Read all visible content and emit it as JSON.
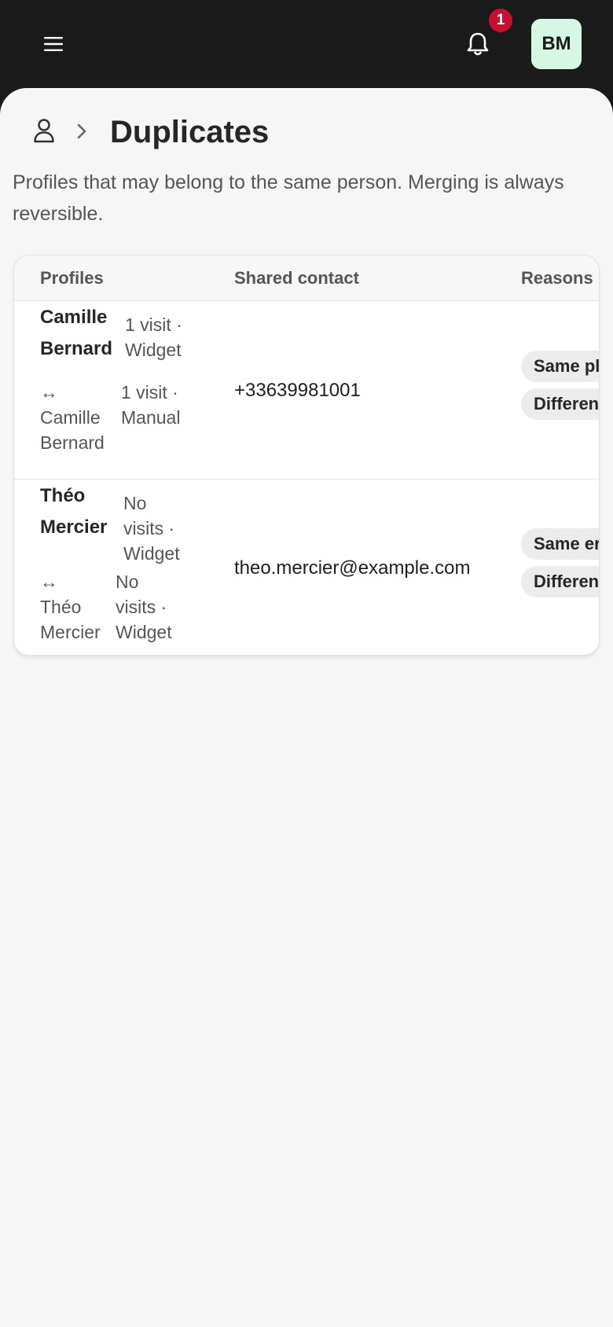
{
  "header": {
    "menu_icon": "hamburger-menu-icon",
    "bell_icon": "bell-icon",
    "notification_count": "1",
    "avatar_initials": "BM",
    "avatar_color": "#d6f7e3",
    "badge_color": "#c8102e"
  },
  "breadcrumb": {
    "root_icon": "person-icon",
    "separator_icon": "chevron-right-icon",
    "title": "Duplicates"
  },
  "description": "Profiles that may belong to the same person. Merging is always reversible.",
  "table": {
    "columns": [
      "Profiles",
      "Shared contact",
      "Reasons"
    ],
    "rows": [
      {
        "primary_name": "Camille Bernard",
        "primary_meta": "1 visit · Widget",
        "arrow": "↔",
        "alt_name": "Camille Bernard",
        "alt_meta": "1 visit · Manual",
        "shared_contact": "+33639981001",
        "reasons": [
          "Same pl",
          "Differen"
        ]
      },
      {
        "primary_name": "Théo Mercier",
        "primary_meta": "No visits · Widget",
        "arrow": "↔",
        "alt_name": "Théo Mercier",
        "alt_meta": "No visits · Widget",
        "shared_contact": "theo.mercier@example.com",
        "reasons": [
          "Same er",
          "Differen"
        ]
      }
    ]
  }
}
